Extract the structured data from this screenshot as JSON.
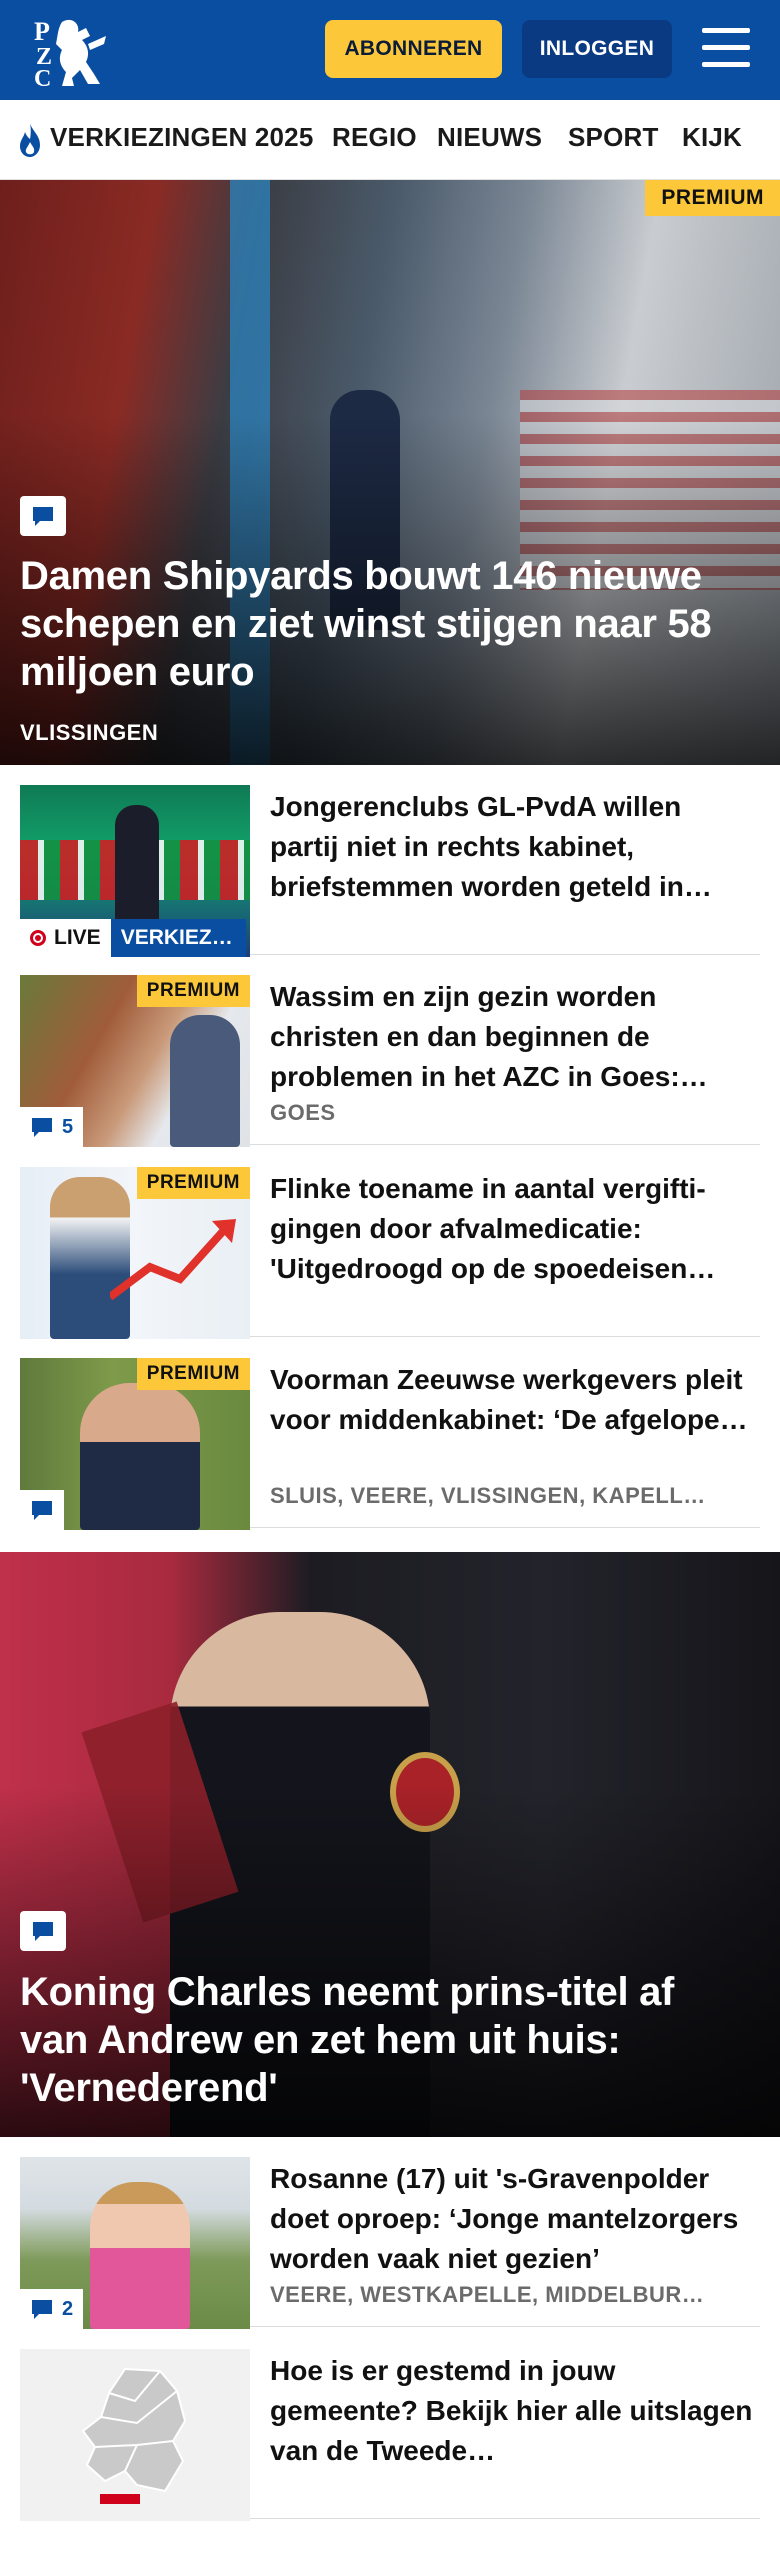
{
  "header": {
    "logo_text": "PZC",
    "subscribe_label": "ABONNEREN",
    "login_label": "INLOGGEN",
    "menu_icon": "hamburger-menu-icon",
    "brand_color": "#0a4ea2",
    "accent_color": "#fcc83a"
  },
  "nav": {
    "items": [
      {
        "label": "VERKIEZINGEN 2025",
        "icon": "flame-icon"
      },
      {
        "label": "REGIO"
      },
      {
        "label": "NIEUWS"
      },
      {
        "label": "SPORT"
      },
      {
        "label": "KIJK"
      }
    ]
  },
  "hero1": {
    "premium": "PREMIUM",
    "title": "Damen Shipyards bouwt 146 nieuwe schepen en ziet winst stijgen naar 58 miljoen euro",
    "location": "VLISSINGEN",
    "icon": "comment-icon"
  },
  "articles": [
    {
      "title": "Jongerenclubs GL-PvdA willen partij niet in rechts kabinet, briefstemmen worden geteld in…",
      "live": "LIVE",
      "category": "VERKIEZ…"
    },
    {
      "title": "Wassim en zijn gezin worden christen en dan beginnen de problemen in het AZC in Goes:…",
      "premium": "PREMIUM",
      "comments": "5",
      "location": "GOES"
    },
    {
      "title": "Flinke toename in aantal vergifti­gingen door afvalmedicatie: 'Uitgedroogd op de spoedeisen…",
      "premium": "PREMIUM"
    },
    {
      "title": "Voorman Zeeuwse werkgevers pleit voor middenkabinet: ‘De afgelopen twee jaar is er niets…",
      "premium": "PREMIUM",
      "location": "SLUIS, VEERE, VLISSINGEN, KAPELL…"
    }
  ],
  "hero2": {
    "title": "Koning Charles neemt prins-titel af van Andrew en zet hem uit huis: 'Vernederend'",
    "icon": "comment-icon"
  },
  "articles2": [
    {
      "title": "Rosanne (17) uit 's-Gravenpolder doet oproep: ‘Jonge mantelzor­gers worden vaak niet gezien’",
      "comments": "2",
      "location": "VEERE, WESTKAPELLE, MIDDELBUR…"
    },
    {
      "title": "Hoe is er gestemd in jouw gemeente? Bekijk hier alle uitslagen van de Tweede…"
    }
  ]
}
